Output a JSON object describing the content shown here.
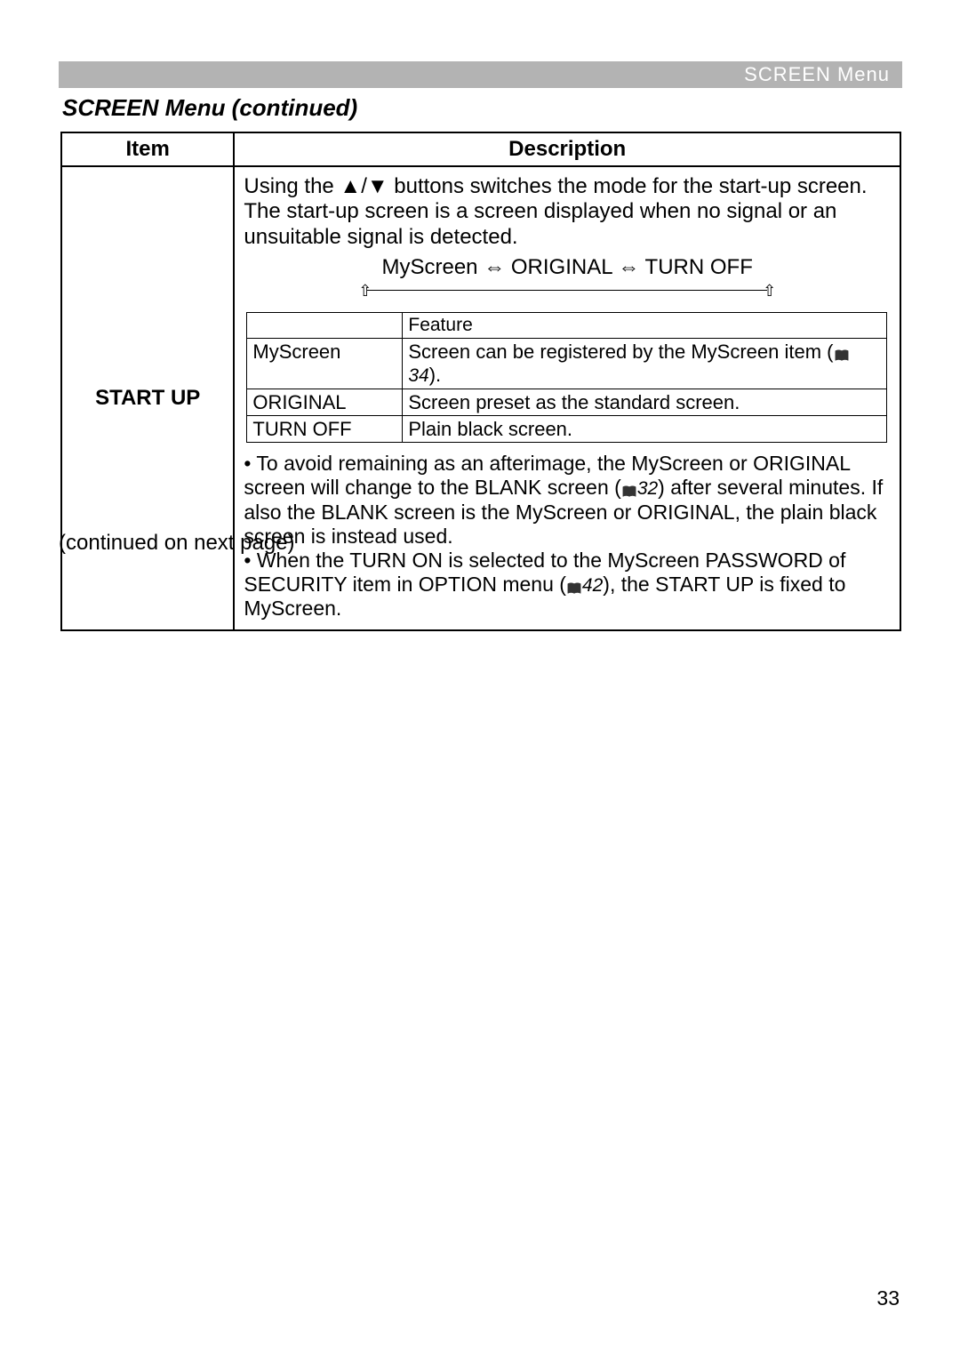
{
  "header": {
    "bar_text": "SCREEN Menu"
  },
  "section_title": "SCREEN Menu (continued)",
  "table": {
    "col_item": "Item",
    "col_desc": "Description",
    "item_label": "START UP",
    "intro_1": "Using the ▲/▼ buttons switches the mode for the start-up screen.",
    "intro_2": "The start-up screen is a screen displayed when no signal or an unsuitable signal is detected.",
    "cycle": "MyScreen ⇔ ORIGINAL ⇔ TURN OFF",
    "inner": {
      "feature_header": "Feature",
      "r1_a": "MyScreen",
      "r1_b_pre": "Screen can be registered by the MyScreen item (",
      "r1_b_ref": "34",
      "r1_b_post": ").",
      "r2_a": "ORIGINAL",
      "r2_b": "Screen preset as the standard screen.",
      "r3_a": "TURN OFF",
      "r3_b": "Plain black screen."
    },
    "note1_a": "• To avoid remaining as an afterimage, the MyScreen or ORIGINAL screen will change to the BLANK screen (",
    "note1_ref": "32",
    "note1_b": ") after several minutes. If also the BLANK screen is the MyScreen or ORIGINAL, the plain black screen is instead used.",
    "note2_a": "• When the TURN ON is selected to the MyScreen PASSWORD of SECURITY item in OPTION menu (",
    "note2_ref": "42",
    "note2_b": "), the START UP is fixed to MyScreen."
  },
  "continued_text": "(continued on next page)",
  "page_number": "33"
}
